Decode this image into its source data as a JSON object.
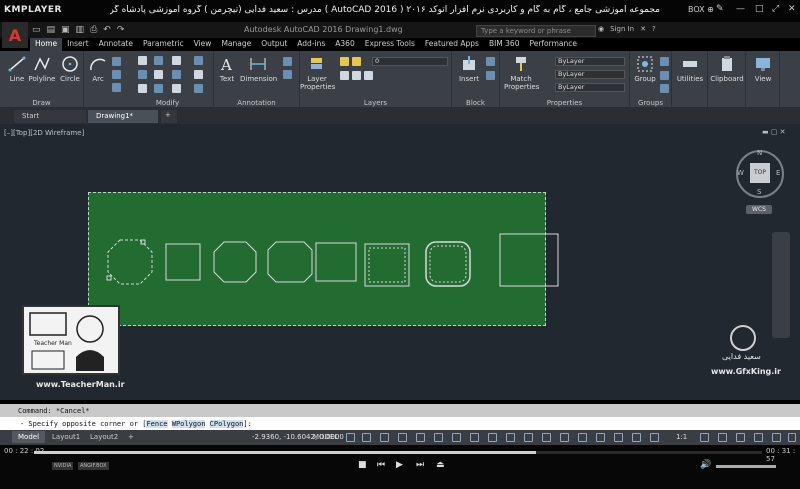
{
  "player": {
    "logo": "KMPLAYER",
    "title": "مجموعه آموزشی جامع ، گام به گام و کاربردی نرم افزار اتوکد ۲۰۱۶ ( AutoCAD 2016 ) مدرس : سعید فدایی (تیچرمن ) گروه آموزشی پادشاه گرافیست ها",
    "box_label": "BOX ⊕",
    "time_elapsed": "00 : 22 : 02",
    "time_total": "00 : 31 : 57",
    "progress_fraction": 0.69,
    "badges": [
      "NVIDIA",
      "ANGIF.BOX"
    ]
  },
  "acad": {
    "document_title": "Autodesk AutoCAD 2016     Drawing1.dwg",
    "search_placeholder": "Type a keyword or phrase",
    "signin": "Sign In",
    "ribbon_tabs": [
      "Home",
      "Insert",
      "Annotate",
      "Parametric",
      "View",
      "Manage",
      "Output",
      "Add-ins",
      "A360",
      "Express Tools",
      "Featured Apps",
      "BIM 360",
      "Performance"
    ],
    "active_tab": "Home",
    "panels": {
      "draw": {
        "label": "Draw",
        "tools": [
          "Line",
          "Polyline",
          "Circle",
          "Arc"
        ]
      },
      "modify": {
        "label": "Modify"
      },
      "annotation": {
        "label": "Annotation",
        "tools": [
          "Text",
          "Dimension"
        ]
      },
      "layers": {
        "label": "Layers",
        "tool": "Layer Properties",
        "current_layer": "0"
      },
      "block": {
        "label": "Block",
        "tool": "Insert"
      },
      "properties": {
        "label": "Properties",
        "tool": "Match Properties",
        "color": "ByLayer",
        "linetype": "ByLayer",
        "lineweight": "ByLayer"
      },
      "groups": {
        "label": "Groups",
        "tool": "Group"
      },
      "utilities": {
        "tool": "Utilities"
      },
      "clipboard": {
        "tool": "Clipboard"
      },
      "view": {
        "tool": "View"
      }
    },
    "file_tabs": [
      "Start",
      "Drawing1*"
    ],
    "active_file_tab": "Drawing1*",
    "view_label": "[–][Top][2D Wireframe]",
    "viewcube": {
      "face": "TOP",
      "north": "N",
      "south": "S",
      "east": "E",
      "west": "W",
      "wcs": "WCS"
    },
    "command_history": "Command: *Cancel*",
    "command_prompt": "- Specify opposite corner or [",
    "command_options": [
      "Fence",
      "WPolygon",
      "CPolygon"
    ],
    "command_tail": "]:",
    "layout_tabs": [
      "Model",
      "Layout1",
      "Layout2"
    ],
    "active_layout": "Model",
    "coordinates": "-2.9360, -10.6042, 0.0000",
    "model_button": "MODEL",
    "annotation_scale": "1:1"
  },
  "watermark": {
    "teacher_url": "www.TeacherMan.ir",
    "teacher_label": "Teacher Man",
    "gfx_signature": "سعید فدایی",
    "gfx_url": "www.GfxKing.ir"
  },
  "colors": {
    "selection": "#227832",
    "drawing_bg": "#212830",
    "ribbon": "#3b4046",
    "shape_stroke": "#d8d8d8"
  }
}
